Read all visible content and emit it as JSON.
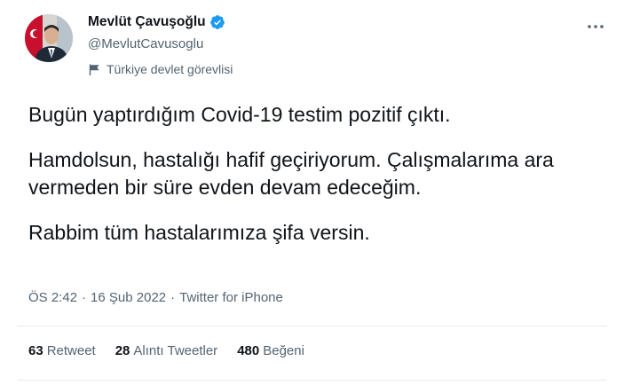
{
  "author": {
    "display_name": "Mevlüt Çavuşoğlu",
    "handle": "@MevlutCavusoglu",
    "account_label": "Türkiye devlet görevlisi"
  },
  "tweet": {
    "lines": [
      "Bugün yaptırdığım Covid-19 testim pozitif çıktı.",
      "Hamdolsun, hastalığı hafif geçiriyorum. Çalışmalarıma ara vermeden bir süre evden devam edeceğim.",
      "Rabbim tüm hastalarımıza şifa versin."
    ],
    "time": "ÖS 2:42",
    "date": "16 Şub 2022",
    "source": "Twitter for iPhone",
    "separator": "·"
  },
  "stats": {
    "retweets_count": "63",
    "retweets_label": "Retweet",
    "quotes_count": "28",
    "quotes_label": "Alıntı Tweetler",
    "likes_count": "480",
    "likes_label": "Beğeni"
  },
  "icons": {
    "verified": "verified-badge-icon",
    "gov_label": "government-flag-icon",
    "more": "more-options-icon"
  },
  "colors": {
    "verified_blue": "#1d9bf0",
    "secondary_text": "#536471",
    "primary_text": "#0f1419",
    "divider": "#e6ecf0"
  }
}
